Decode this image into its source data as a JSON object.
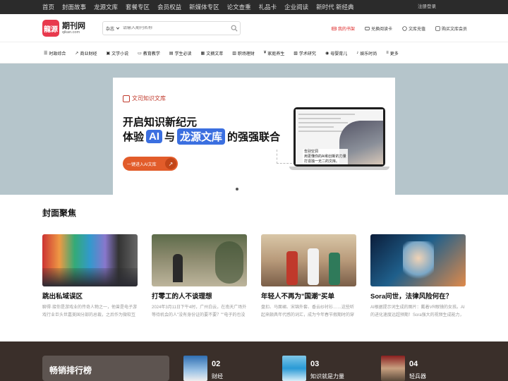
{
  "topbar": {
    "nav": [
      "首页",
      "封面故事",
      "龙源文库",
      "套餐专区",
      "会员权益",
      "新媒体专区",
      "论文查重",
      "礼品卡",
      "企业阅读",
      "新时代 新经典"
    ],
    "login": "注册登录"
  },
  "header": {
    "logo_cn": "期刊网",
    "logo_en": "qikan.com",
    "logo_mark": "龍源",
    "search_category": "杂志",
    "search_placeholder": "请输入期刊名称",
    "links": [
      {
        "label": "我的书架",
        "icon": "bookshelf-icon",
        "highlight": true
      },
      {
        "label": "兑换阅读卡",
        "icon": "card-icon",
        "highlight": false
      },
      {
        "label": "文库充值",
        "icon": "recharge-icon",
        "highlight": false
      },
      {
        "label": "购买文库会员",
        "icon": "vip-icon",
        "highlight": false
      }
    ]
  },
  "categories": [
    {
      "label": "时政综合",
      "icon": "list-icon"
    },
    {
      "label": "商业财经",
      "icon": "chart-icon"
    },
    {
      "label": "文学小说",
      "icon": "book-icon"
    },
    {
      "label": "教育教学",
      "icon": "teach-icon"
    },
    {
      "label": "学生必读",
      "icon": "student-icon"
    },
    {
      "label": "文摘文萃",
      "icon": "digest-icon"
    },
    {
      "label": "职场理财",
      "icon": "briefcase-icon"
    },
    {
      "label": "家庭养生",
      "icon": "home-icon"
    },
    {
      "label": "学术研究",
      "icon": "research-icon"
    },
    {
      "label": "母婴育儿",
      "icon": "baby-icon"
    },
    {
      "label": "娱乐时尚",
      "icon": "music-icon"
    },
    {
      "label": "更多",
      "icon": "more-icon"
    }
  ],
  "banner": {
    "brand": "文司知识文库",
    "line1": "开启知识新纪元",
    "line2_pre": "体验",
    "line2_ai": "AI",
    "line2_mid": "与",
    "line2_lib": "龙源文库",
    "line2_post": "的强强联合",
    "cta": "一键进入AI文库",
    "cta_arrow": "↗",
    "note_l1": "告别空洞",
    "note_l2": "用更懂你的AI和创新的力量",
    "note_l3": "打造独一无二的文库。"
  },
  "featured": {
    "title": "封面聚焦",
    "items": [
      {
        "title": "跳出私域误区",
        "desc": "聊得·接你是游戏业的传奇人物之一，他曾是电子游戏行业巨头世嘉美国分部的总裁，之后作为微软互动娱乐部门副总裁全程推"
      },
      {
        "title": "打零工的人不谈理想",
        "desc": "2024年3月11日下午4时，广州白云，在南天广场外等待机会的人\"没有身份证的要不要？\"\"电子的也没有？没有不要。\"下午"
      },
      {
        "title": "年轻人不再为\"国潮\"买单",
        "desc": "盘扣、马面裙、宋锦外套、香云纱衬衫……这些听起来颇具年代感的词汇，成为今年春节假期时的穿搭密码。多个电商平台数据显"
      },
      {
        "title": "Sora问世，法律风险何在？",
        "desc": "AI根据提示词生成的图片：戴着VR眼镜的女孩。AI的进化速度远超预期！Sora强大的视频生成能力，在今日界。艺术界和科"
      }
    ]
  },
  "ranking": {
    "title": "畅销排行榜",
    "items": [
      {
        "num": "02",
        "name": "财经"
      },
      {
        "num": "03",
        "name": "知识就是力量"
      },
      {
        "num": "04",
        "name": "轻兵器"
      }
    ]
  }
}
